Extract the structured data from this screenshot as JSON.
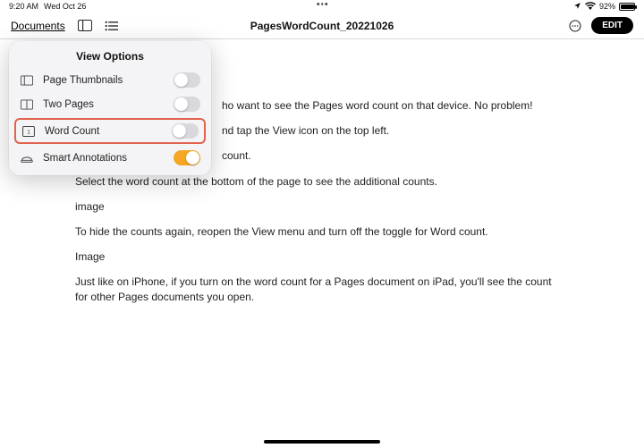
{
  "status": {
    "time": "9:20 AM",
    "date": "Wed Oct 26",
    "battery_pct": "92%"
  },
  "titlebar": {
    "documents_label": "Documents",
    "doc_title": "PagesWordCount_20221026",
    "edit_label": "EDIT"
  },
  "popover": {
    "title": "View Options",
    "items": [
      {
        "label": "Page Thumbnails",
        "on": false
      },
      {
        "label": "Two Pages",
        "on": false
      },
      {
        "label": "Word Count",
        "on": false,
        "highlighted": true
      },
      {
        "label": "Smart Annotations",
        "on": true
      }
    ]
  },
  "body": {
    "p0": "ho want to see the Pages word count on that device. No problem!",
    "p1": "nd tap the View icon on the top left.",
    "p2": "count.",
    "p3": "Select the word count at the bottom of the page to see the additional counts.",
    "p4": "image",
    "p5": "To hide the counts again, reopen the View menu and turn off the toggle for Word count.",
    "p6": "Image",
    "p7": "Just like on iPhone, if you turn on the word count for a Pages document on iPad, you'll see the count for other Pages documents you open."
  }
}
